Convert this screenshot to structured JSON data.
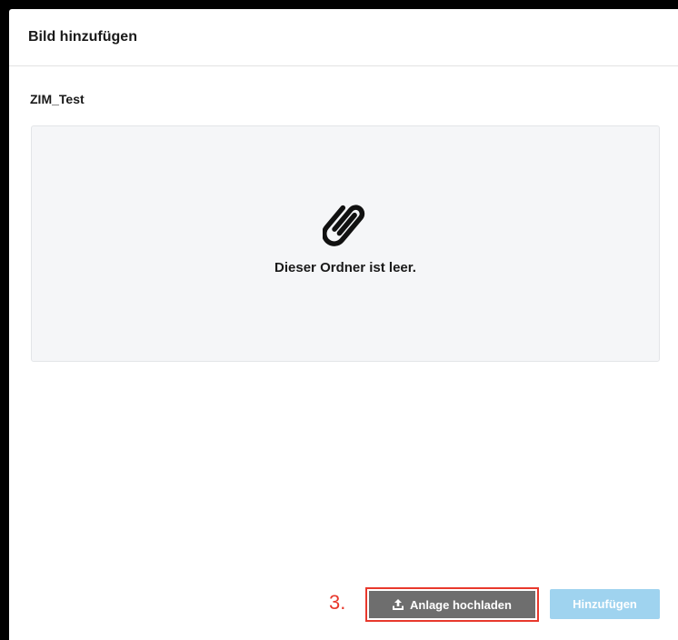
{
  "dialog": {
    "title": "Bild hinzufügen",
    "folder_name": "ZIM_Test",
    "empty_message": "Dieser Ordner ist leer.",
    "empty_icon": "paperclip-icon"
  },
  "footer": {
    "step_label": "3.",
    "upload_label": "Anlage hochladen",
    "upload_icon": "upload-icon",
    "add_label": "Hinzufügen"
  },
  "colors": {
    "highlight": "#e8382c",
    "upload_bg": "#6e6e6e",
    "add_bg": "#9fd3ef"
  }
}
